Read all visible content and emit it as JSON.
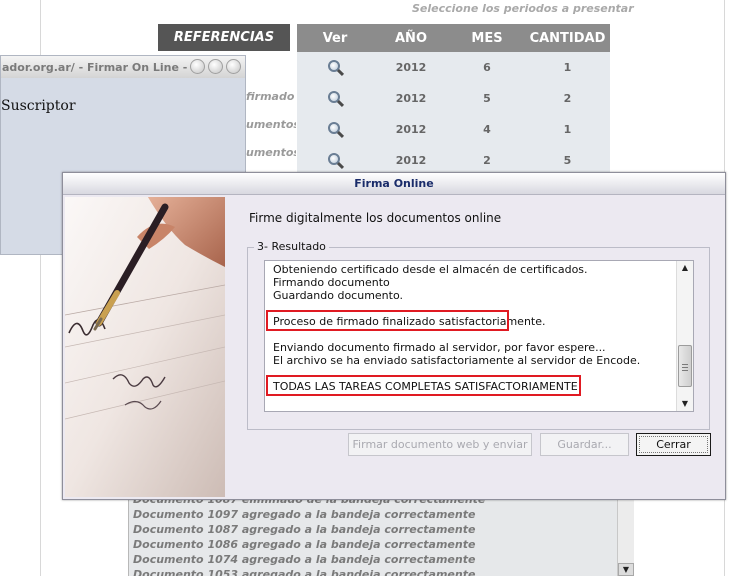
{
  "page": {
    "hint": "Seleccione los periodos a presentar",
    "references": {
      "header": "REFERENCIAS",
      "items": [
        "firmado",
        "umentos",
        "umentos"
      ]
    },
    "table": {
      "headers": [
        "Ver",
        "AÑO",
        "MES",
        "CANTIDAD"
      ],
      "rows": [
        {
          "year": "2012",
          "month": "6",
          "count": "1"
        },
        {
          "year": "2012",
          "month": "5",
          "count": "2"
        },
        {
          "year": "2012",
          "month": "4",
          "count": "1"
        },
        {
          "year": "2012",
          "month": "2",
          "count": "5"
        }
      ]
    },
    "log": [
      "Documento 1087 eliminado de la bandeja correctamente",
      "Documento 1097 agregado a la bandeja correctamente",
      "Documento 1087 agregado a la bandeja correctamente",
      "Documento 1086 agregado a la bandeja correctamente",
      "Documento 1074 agregado a la bandeja correctamente",
      "Documento 1053 agregado a la bandeja correctamente"
    ]
  },
  "background_window": {
    "title": "ador.org.ar/ - Firmar On Line - ...",
    "body_text": "Suscriptor"
  },
  "dialog": {
    "title": "Firma Online",
    "heading": "Firme digitalmente los documentos online",
    "group_label": "3- Resultado",
    "lines": [
      "Obteniendo certificado desde el almacén de certificados.",
      "Firmando documento",
      "Guardando documento.",
      "Proceso de firmado finalizado satisfactoriamente.",
      "Enviando documento firmado al servidor, por favor espere...",
      "El archivo se ha enviado satisfactoriamente al servidor de Encode.",
      "TODAS LAS TAREAS COMPLETAS SATISFACTORIAMENTE"
    ],
    "buttons": {
      "sign": "Firmar documento web y enviar",
      "save": "Guardar...",
      "close": "Cerrar"
    }
  },
  "colors": {
    "highlight_border": "#e01a22",
    "dialog_title_text": "#1a2c6a",
    "table_header_bg": "#8c8c8c",
    "references_header_bg": "#555555"
  }
}
